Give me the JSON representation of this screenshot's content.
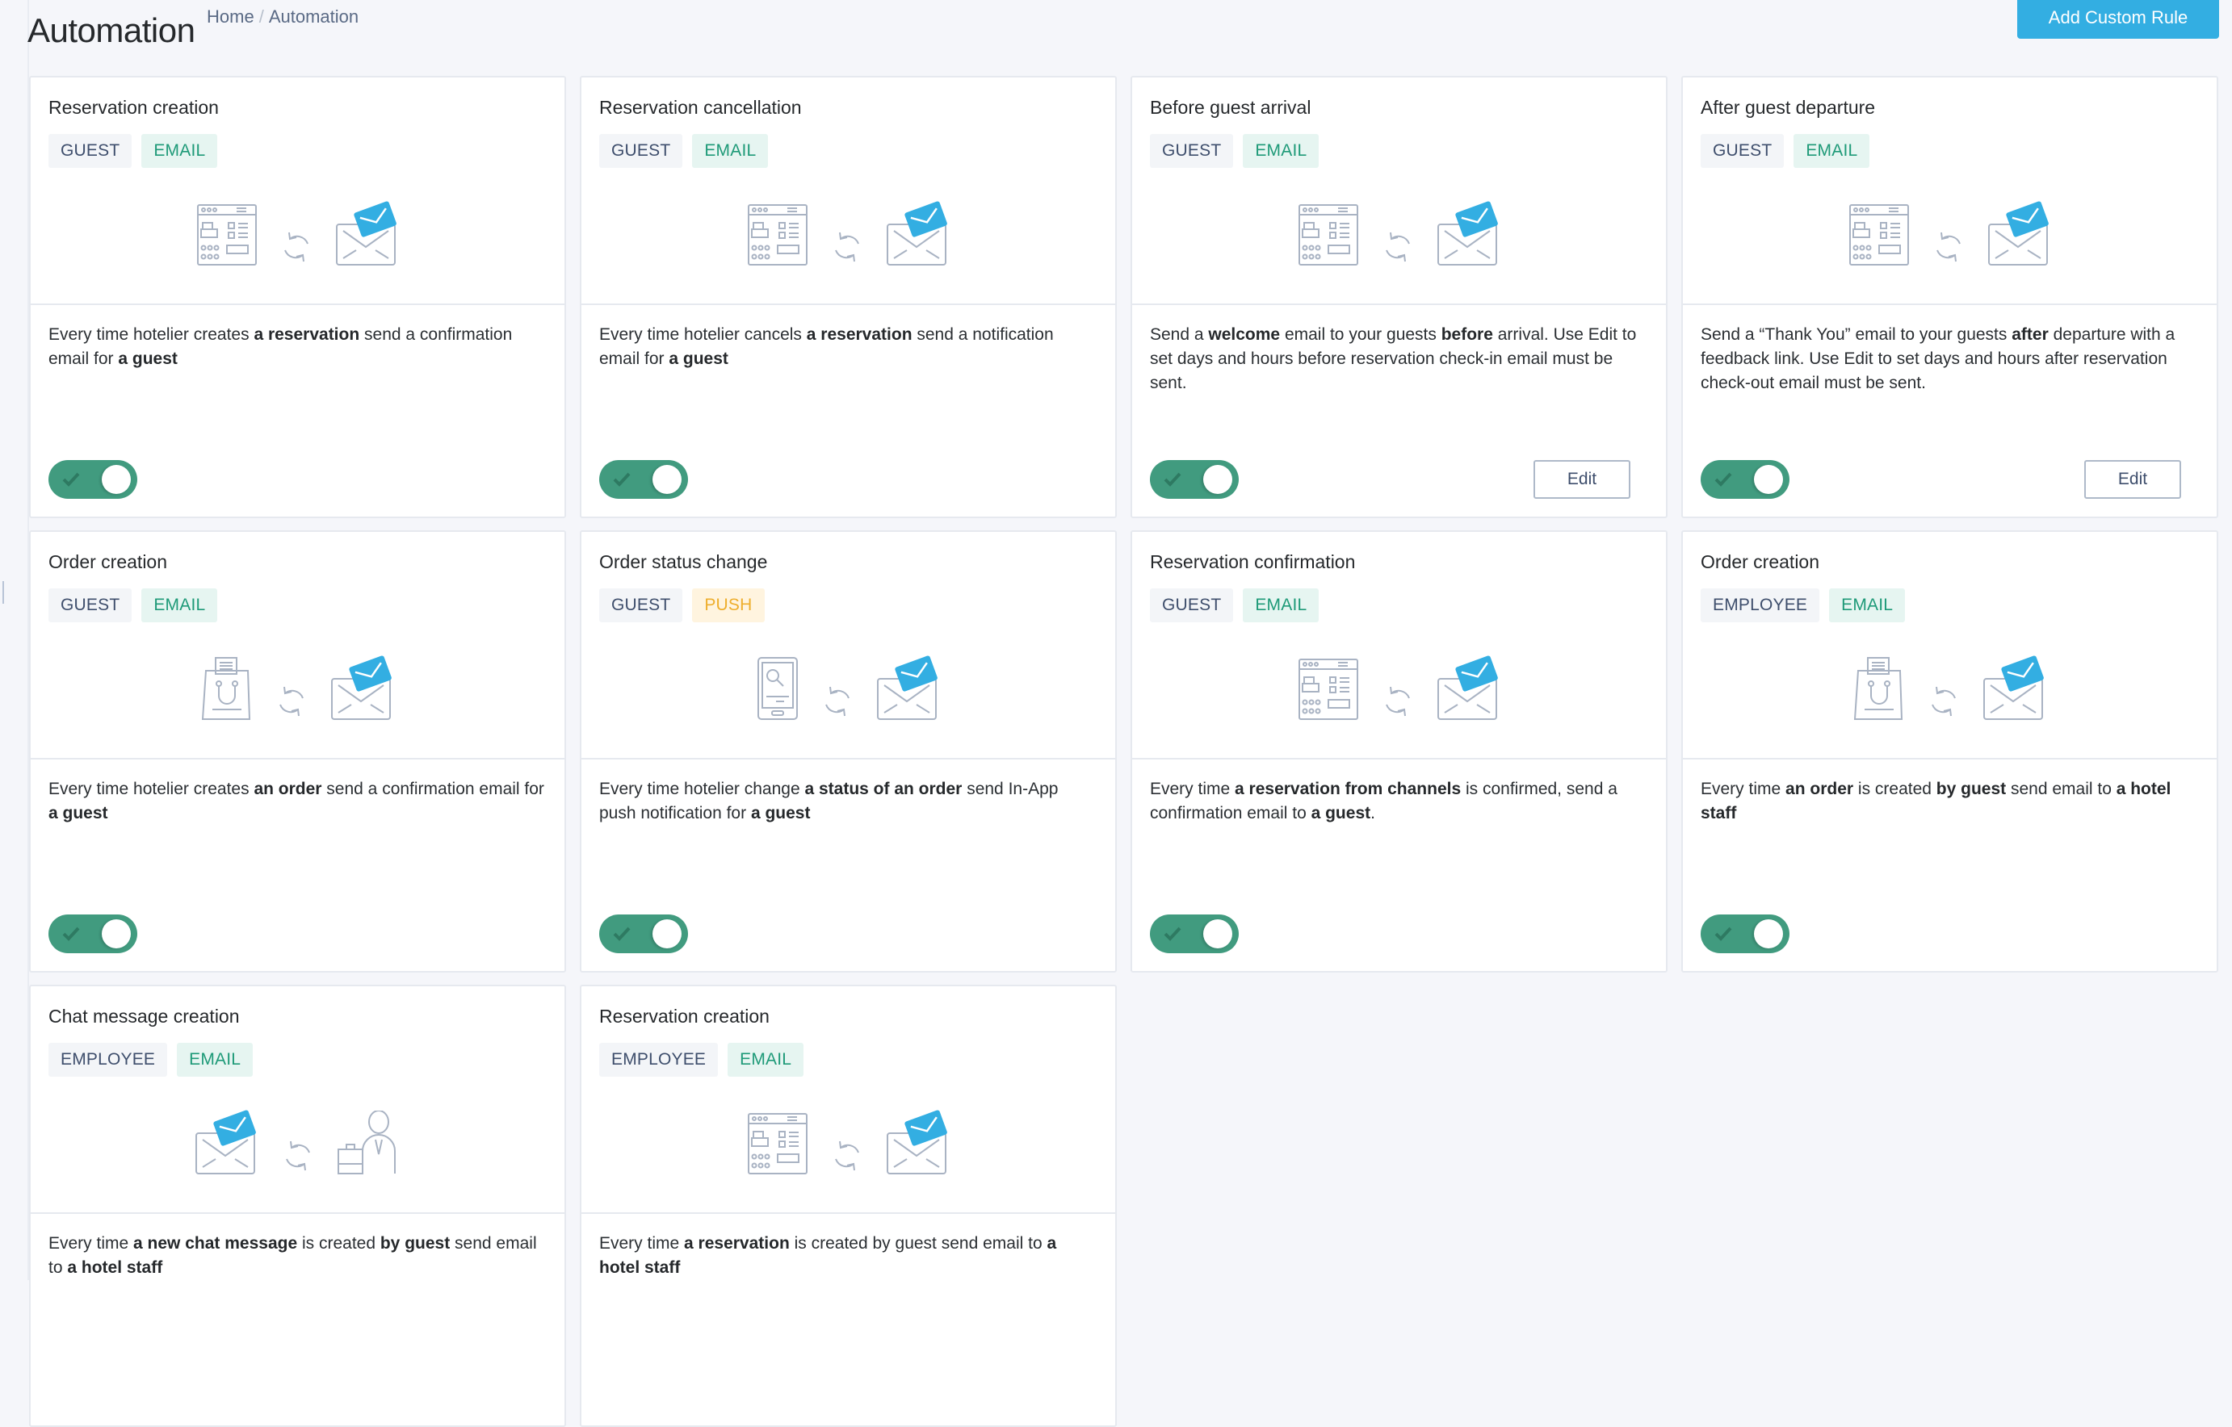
{
  "header": {
    "title": "Automation",
    "breadcrumb": [
      "Home",
      "Automation"
    ],
    "breadcrumb_separator": "/",
    "add_button_label": "Add Custom Rule"
  },
  "colors": {
    "primary_button": "#33aee2",
    "toggle_on": "#419b7f",
    "email_tag_text": "#1e9a78",
    "push_tag_text": "#eeae2c",
    "envelope_accent": "#33aee2"
  },
  "edit_label": "Edit",
  "cards": [
    {
      "title": "Reservation creation",
      "tags": [
        {
          "label": "GUEST",
          "kind": "audience"
        },
        {
          "label": "EMAIL",
          "kind": "email"
        }
      ],
      "illustration": {
        "from": "booking-calendar-icon",
        "to": "email-envelope-icon"
      },
      "description": [
        [
          "Every time hotelier creates ",
          false
        ],
        [
          "a reservation",
          true
        ],
        [
          " send a confirmation email for ",
          false
        ],
        [
          "a guest",
          true
        ]
      ],
      "enabled": true,
      "has_edit": false
    },
    {
      "title": "Reservation cancellation",
      "tags": [
        {
          "label": "GUEST",
          "kind": "audience"
        },
        {
          "label": "EMAIL",
          "kind": "email"
        }
      ],
      "illustration": {
        "from": "booking-calendar-icon",
        "to": "email-envelope-icon"
      },
      "description": [
        [
          "Every time hotelier cancels ",
          false
        ],
        [
          "a reservation",
          true
        ],
        [
          " send a notification email for ",
          false
        ],
        [
          "a guest",
          true
        ]
      ],
      "enabled": true,
      "has_edit": false
    },
    {
      "title": "Before guest arrival",
      "tags": [
        {
          "label": "GUEST",
          "kind": "audience"
        },
        {
          "label": "EMAIL",
          "kind": "email"
        }
      ],
      "illustration": {
        "from": "booking-calendar-icon",
        "to": "email-envelope-icon"
      },
      "description": [
        [
          "Send a ",
          false
        ],
        [
          "welcome",
          true
        ],
        [
          " email to your guests ",
          false
        ],
        [
          "before",
          true
        ],
        [
          " arrival. Use Edit to set days and hours before reservation check-in email must be sent.",
          false
        ]
      ],
      "enabled": true,
      "has_edit": true
    },
    {
      "title": "After guest departure",
      "tags": [
        {
          "label": "GUEST",
          "kind": "audience"
        },
        {
          "label": "EMAIL",
          "kind": "email"
        }
      ],
      "illustration": {
        "from": "booking-calendar-icon",
        "to": "email-envelope-icon"
      },
      "description": [
        [
          "Send a “Thank You” email to your guests ",
          false
        ],
        [
          "after",
          true
        ],
        [
          " departure with a feedback link. Use Edit to set days and hours after reservation check-out email must be sent.",
          false
        ]
      ],
      "enabled": true,
      "has_edit": true
    },
    {
      "title": "Order creation",
      "tags": [
        {
          "label": "GUEST",
          "kind": "audience"
        },
        {
          "label": "EMAIL",
          "kind": "email"
        }
      ],
      "illustration": {
        "from": "shopping-bag-icon",
        "to": "email-envelope-icon"
      },
      "description": [
        [
          "Every time hotelier creates ",
          false
        ],
        [
          "an order",
          true
        ],
        [
          " send a confirmation email for ",
          false
        ],
        [
          "a guest",
          true
        ]
      ],
      "enabled": true,
      "has_edit": false
    },
    {
      "title": "Order status change",
      "tags": [
        {
          "label": "GUEST",
          "kind": "audience"
        },
        {
          "label": "PUSH",
          "kind": "push"
        }
      ],
      "illustration": {
        "from": "smartphone-icon",
        "to": "email-envelope-icon"
      },
      "description": [
        [
          "Every time hotelier change ",
          false
        ],
        [
          "a status of an order",
          true
        ],
        [
          " send In-App push notification for ",
          false
        ],
        [
          "a guest",
          true
        ]
      ],
      "enabled": true,
      "has_edit": false
    },
    {
      "title": "Reservation confirmation",
      "tags": [
        {
          "label": "GUEST",
          "kind": "audience"
        },
        {
          "label": "EMAIL",
          "kind": "email"
        }
      ],
      "illustration": {
        "from": "booking-calendar-icon",
        "to": "email-envelope-icon"
      },
      "description": [
        [
          "Every time ",
          false
        ],
        [
          "a reservation from channels",
          true
        ],
        [
          " is confirmed, send a confirmation email to ",
          false
        ],
        [
          "a guest",
          true
        ],
        [
          ".",
          false
        ]
      ],
      "enabled": true,
      "has_edit": false
    },
    {
      "title": "Order creation",
      "tags": [
        {
          "label": "EMPLOYEE",
          "kind": "audience"
        },
        {
          "label": "EMAIL",
          "kind": "email"
        }
      ],
      "illustration": {
        "from": "shopping-bag-icon",
        "to": "email-envelope-icon"
      },
      "description": [
        [
          "Every time ",
          false
        ],
        [
          "an order",
          true
        ],
        [
          " is created ",
          false
        ],
        [
          "by guest",
          true
        ],
        [
          " send email to ",
          false
        ],
        [
          "a hotel staff",
          true
        ]
      ],
      "enabled": true,
      "has_edit": false
    },
    {
      "title": "Chat message creation",
      "tags": [
        {
          "label": "EMPLOYEE",
          "kind": "audience"
        },
        {
          "label": "EMAIL",
          "kind": "email"
        }
      ],
      "illustration": {
        "from": "email-envelope-icon",
        "to": "hotel-staff-icon"
      },
      "description": [
        [
          "Every time ",
          false
        ],
        [
          "a new chat message",
          true
        ],
        [
          " is created ",
          false
        ],
        [
          "by guest",
          true
        ],
        [
          " send email to ",
          false
        ],
        [
          "a hotel staff",
          true
        ]
      ],
      "enabled": null,
      "has_edit": false
    },
    {
      "title": "Reservation creation",
      "tags": [
        {
          "label": "EMPLOYEE",
          "kind": "audience"
        },
        {
          "label": "EMAIL",
          "kind": "email"
        }
      ],
      "illustration": {
        "from": "booking-calendar-icon",
        "to": "email-envelope-icon"
      },
      "description": [
        [
          "Every time ",
          false
        ],
        [
          "a reservation",
          true
        ],
        [
          " is created by guest send email to ",
          false
        ],
        [
          "a hotel staff",
          true
        ]
      ],
      "enabled": null,
      "has_edit": false
    }
  ]
}
